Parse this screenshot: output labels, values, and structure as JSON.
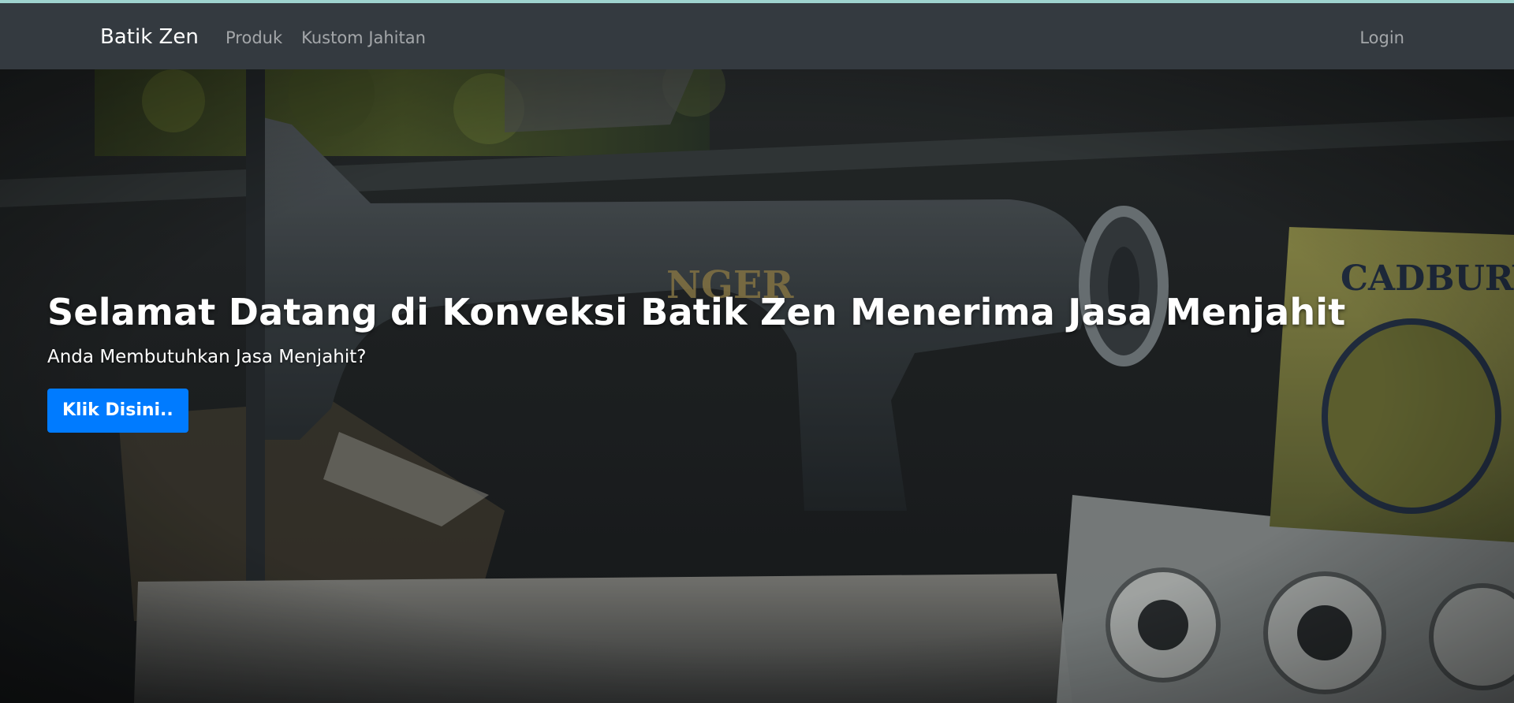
{
  "navbar": {
    "brand": "Batik Zen",
    "links": [
      {
        "label": "Produk"
      },
      {
        "label": "Kustom Jahitan"
      }
    ],
    "login_label": "Login"
  },
  "hero": {
    "title": "Selamat Datang di Konveksi Batik Zen Menerima Jasa Menjahit",
    "subtitle": "Anda Membutuhkan Jasa Menjahit?",
    "cta_label": "Klik Disini.."
  },
  "colors": {
    "navbar_bg": "#343a40",
    "accent_top": "#9fd3cf",
    "cta_bg": "#007bff",
    "text_muted": "rgba(255,255,255,0.55)"
  },
  "images": {
    "hero_background": "vintage-sewing-machine-photo"
  }
}
